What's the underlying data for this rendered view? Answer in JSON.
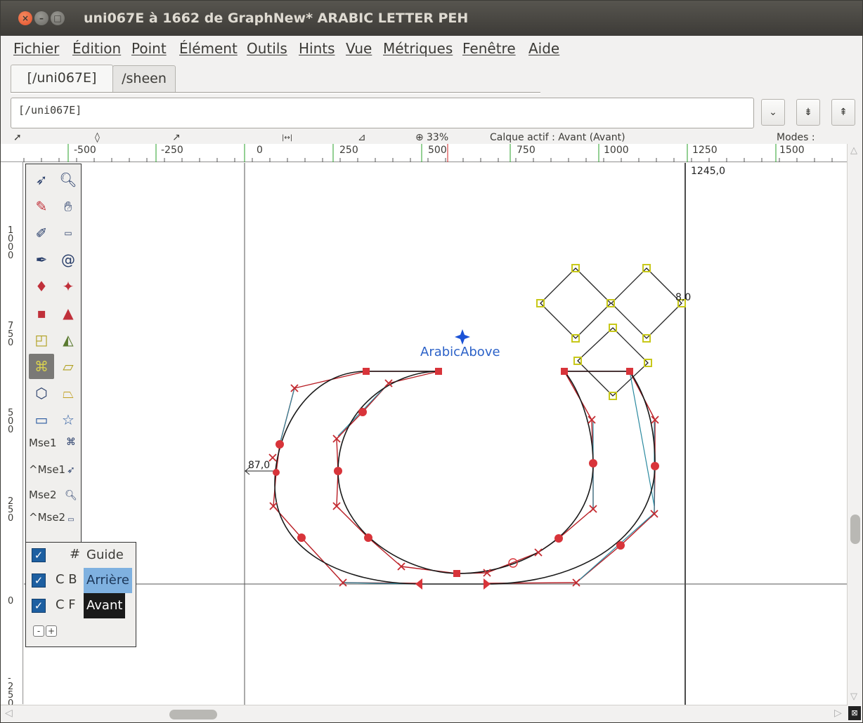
{
  "window": {
    "title": "uni067E à 1662 de GraphNew* ARABIC LETTER PEH"
  },
  "menu": [
    "Fichier",
    "Édition",
    "Point",
    "Élément",
    "Outils",
    "Hints",
    "Vue",
    "Métriques",
    "Fenêtre",
    "Aide"
  ],
  "tabs": [
    "[/uni067E]",
    "/sheen"
  ],
  "wordlist": {
    "value": "[/uni067E]"
  },
  "wordlist_buttons": [
    "⌄",
    "⇟",
    "⇞"
  ],
  "infobar": {
    "zoom": "33%",
    "active_layer": "Calque actif : Avant (Avant)",
    "modes": "Modes :"
  },
  "ruler": {
    "x_labels": [
      "-500",
      "-250",
      "0",
      "250",
      "500",
      "750",
      "1000",
      "1250",
      "1500"
    ],
    "y_labels": [
      "1000",
      "750",
      "500",
      "250",
      "0",
      "-250"
    ]
  },
  "canvas": {
    "advance_width_label": "1245,0",
    "anchor_label": "ArabicAbove",
    "measure_left": "87,0",
    "measure_right": "8,0"
  },
  "tools": [
    "pointer-icon",
    "magnify-icon",
    "pencil-icon",
    "hand-icon",
    "knife-icon",
    "ruler-icon",
    "pen-icon",
    "spiral-icon",
    "curve-point-icon",
    "hv-curve-point-icon",
    "corner-point-icon",
    "tangent-point-icon",
    "scale-icon",
    "flip-icon",
    "rotate-icon",
    "skew-icon",
    "3d-rotate-icon",
    "perspective-icon",
    "rectangle-icon",
    "star-icon"
  ],
  "mouse_bindings": [
    "Mse1",
    "^Mse1",
    "Mse2",
    "^Mse2"
  ],
  "layers": [
    {
      "code": "#",
      "name": "Guide",
      "checked": true
    },
    {
      "code": "C B",
      "name": "Arrière",
      "checked": true
    },
    {
      "code": "C F",
      "name": "Avant",
      "checked": true
    }
  ],
  "layer_buttons": [
    "-",
    "+"
  ]
}
